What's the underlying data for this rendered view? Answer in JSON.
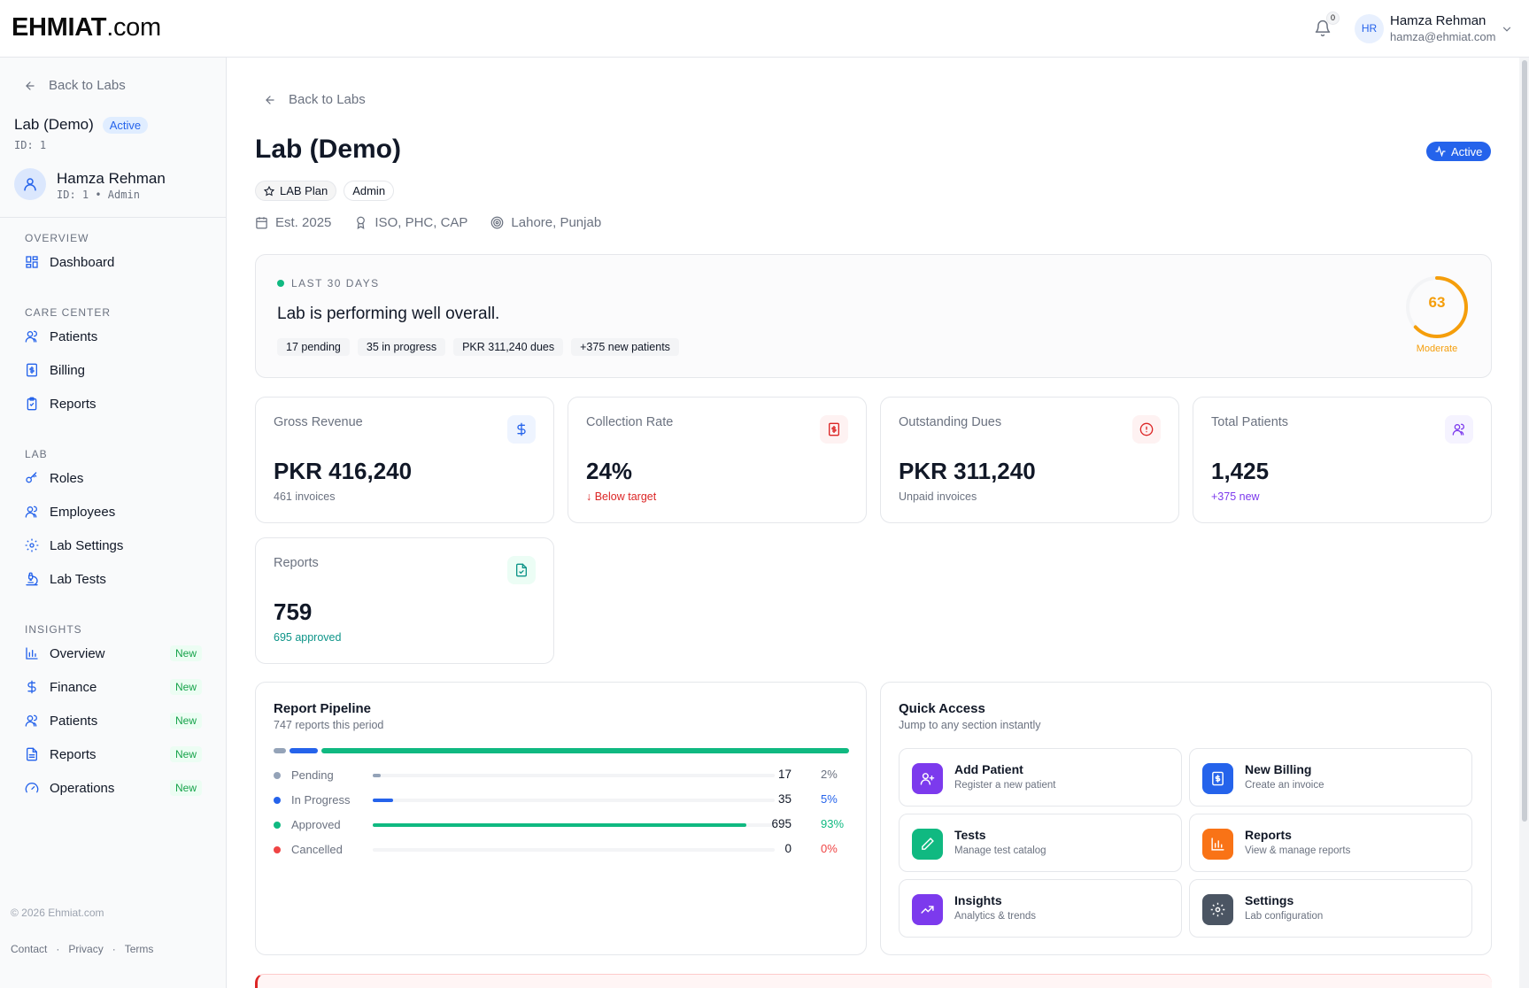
{
  "app": {
    "logo_bold": "EHMIAT",
    "logo_rest": ".com",
    "notifications_count": "0",
    "user_initials": "HR",
    "user_name": "Hamza Rehman",
    "user_email": "hamza@ehmiat.com"
  },
  "sidebar": {
    "back_label": "Back to Labs",
    "lab_title": "Lab (Demo)",
    "lab_status": "Active",
    "lab_id": "ID: 1",
    "user_name": "Hamza Rehman",
    "user_meta": "ID: 1 • Admin",
    "sections": {
      "overview": "OVERVIEW",
      "care_center": "CARE CENTER",
      "lab": "LAB",
      "insights": "INSIGHTS"
    },
    "items": {
      "dashboard": "Dashboard",
      "patients": "Patients",
      "billing": "Billing",
      "reports": "Reports",
      "roles": "Roles",
      "employees": "Employees",
      "lab_settings": "Lab Settings",
      "lab_tests": "Lab Tests",
      "ins_overview": "Overview",
      "ins_finance": "Finance",
      "ins_patients": "Patients",
      "ins_reports": "Reports",
      "ins_operations": "Operations"
    },
    "new_badge": "New",
    "footer": {
      "contact": "Contact",
      "sep": "·",
      "privacy": "Privacy",
      "terms": "Terms",
      "copyright": "© 2026 Ehmiat.com"
    }
  },
  "header": {
    "back_label": "Back to Labs",
    "title": "Lab (Demo)",
    "status": "Active",
    "tags": [
      "LAB Plan",
      "Admin"
    ],
    "est": "Est. 2025",
    "certs": "ISO, PHC, CAP",
    "location": "Lahore, Punjab"
  },
  "summary": {
    "period": "LAST 30 DAYS",
    "headline": "Lab is performing well overall.",
    "chips": [
      "17 pending",
      "35 in progress",
      "PKR 311,240 dues",
      "+375 new patients"
    ],
    "score": "63",
    "score_value": 63,
    "score_label": "Moderate"
  },
  "stats": {
    "gross_revenue": {
      "label": "Gross Revenue",
      "value": "PKR 416,240",
      "sub": "461 invoices"
    },
    "collection_rate": {
      "label": "Collection Rate",
      "value": "24%",
      "sub": "↓ Below target"
    },
    "outstanding_dues": {
      "label": "Outstanding Dues",
      "value": "PKR 311,240",
      "sub": "Unpaid invoices"
    },
    "total_patients": {
      "label": "Total Patients",
      "value": "1,425",
      "sub": "+375 new"
    },
    "reports": {
      "label": "Reports",
      "value": "759",
      "sub": "695 approved"
    }
  },
  "pipeline": {
    "title": "Report Pipeline",
    "subtitle": "747 reports this period",
    "rows": [
      {
        "name": "Pending",
        "count": "17",
        "pct": "2%",
        "fraction": 0.02,
        "color": "#94a3b8",
        "pct_color": "#6b7280"
      },
      {
        "name": "In Progress",
        "count": "35",
        "pct": "5%",
        "fraction": 0.05,
        "color": "#2563eb",
        "pct_color": "#2563eb"
      },
      {
        "name": "Approved",
        "count": "695",
        "pct": "93%",
        "fraction": 0.93,
        "color": "#10b981",
        "pct_color": "#10b981"
      },
      {
        "name": "Cancelled",
        "count": "0",
        "pct": "0%",
        "fraction": 0.0,
        "color": "#ef4444",
        "pct_color": "#ef4444"
      }
    ]
  },
  "quick_access": {
    "title": "Quick Access",
    "subtitle": "Jump to any section instantly",
    "items": [
      {
        "title": "Add Patient",
        "sub": "Register a new patient",
        "color": "#7c3aed"
      },
      {
        "title": "New Billing",
        "sub": "Create an invoice",
        "color": "#2563eb"
      },
      {
        "title": "Tests",
        "sub": "Manage test catalog",
        "color": "#10b981"
      },
      {
        "title": "Reports",
        "sub": "View & manage reports",
        "color": "#f97316"
      },
      {
        "title": "Insights",
        "sub": "Analytics & trends",
        "color": "#7c3aed"
      },
      {
        "title": "Settings",
        "sub": "Lab configuration",
        "color": "#4b5563"
      }
    ]
  },
  "colors": {
    "accent": "#2563eb",
    "success": "#10b981",
    "warning": "#f59e0b",
    "danger": "#dc2626",
    "purple": "#7c3aed"
  }
}
